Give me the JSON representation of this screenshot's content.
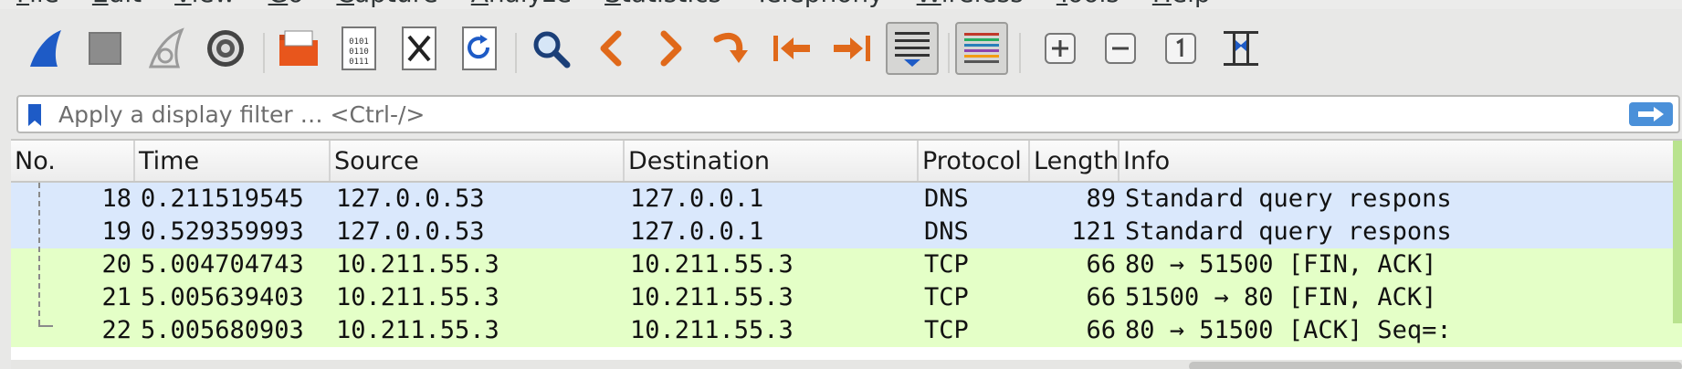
{
  "menu": [
    {
      "label": "File",
      "key": "F",
      "rest": "ile"
    },
    {
      "label": "Edit",
      "key": "E",
      "rest": "dit"
    },
    {
      "label": "View",
      "key": "V",
      "rest": "iew"
    },
    {
      "label": "Go",
      "key": "G",
      "rest": "o"
    },
    {
      "label": "Capture",
      "key": "C",
      "rest": "apture"
    },
    {
      "label": "Analyze",
      "key": "A",
      "rest": "nalyze"
    },
    {
      "label": "Statistics",
      "key": "S",
      "rest": "tatistics"
    },
    {
      "label": "Telephony",
      "key": "",
      "rest": "Telephony"
    },
    {
      "label": "Wireless",
      "key": "W",
      "rest": "ireless"
    },
    {
      "label": "Tools",
      "key": "T",
      "rest": "ools"
    },
    {
      "label": "Help",
      "key": "H",
      "rest": "elp"
    }
  ],
  "toolbar": {
    "icons": [
      "shark-fin-start-icon",
      "stop-square-icon",
      "shark-fin-restart-icon",
      "gear-options-icon",
      "open-folder-icon",
      "binary-file-icon",
      "close-file-icon",
      "reload-file-icon",
      "search-icon",
      "chevron-left-icon",
      "chevron-right-icon",
      "jump-arrow-icon",
      "go-first-icon",
      "go-last-icon",
      "autoscroll-icon",
      "colorize-icon",
      "zoom-in-icon",
      "zoom-out-icon",
      "normal-size-icon",
      "resize-columns-icon"
    ],
    "pressed": [
      "autoscroll-icon",
      "colorize-icon"
    ]
  },
  "filter": {
    "placeholder": "Apply a display filter … <Ctrl-/>",
    "value": ""
  },
  "columns": [
    "No.",
    "Time",
    "Source",
    "Destination",
    "Protocol",
    "Length",
    "Info"
  ],
  "packets": [
    {
      "no": "18",
      "time": "0.211519545",
      "source": "127.0.0.53",
      "destination": "127.0.0.1",
      "protocol": "DNS",
      "length": "89",
      "info": "Standard query respons"
    },
    {
      "no": "19",
      "time": "0.529359993",
      "source": "127.0.0.53",
      "destination": "127.0.0.1",
      "protocol": "DNS",
      "length": "121",
      "info": "Standard query respons"
    },
    {
      "no": "20",
      "time": "5.004704743",
      "source": "10.211.55.3",
      "destination": "10.211.55.3",
      "protocol": "TCP",
      "length": "66",
      "info": "80 → 51500 [FIN, ACK]"
    },
    {
      "no": "21",
      "time": "5.005639403",
      "source": "10.211.55.3",
      "destination": "10.211.55.3",
      "protocol": "TCP",
      "length": "66",
      "info": "51500 → 80 [FIN, ACK]"
    },
    {
      "no": "22",
      "time": "5.005680903",
      "source": "10.211.55.3",
      "destination": "10.211.55.3",
      "protocol": "TCP",
      "length": "66",
      "info": "80 → 51500 [ACK] Seq=:"
    }
  ],
  "colors": {
    "dns_row": "#dae8fc",
    "tcp_row": "#e4ffc7",
    "accent": "#4a90d9"
  }
}
